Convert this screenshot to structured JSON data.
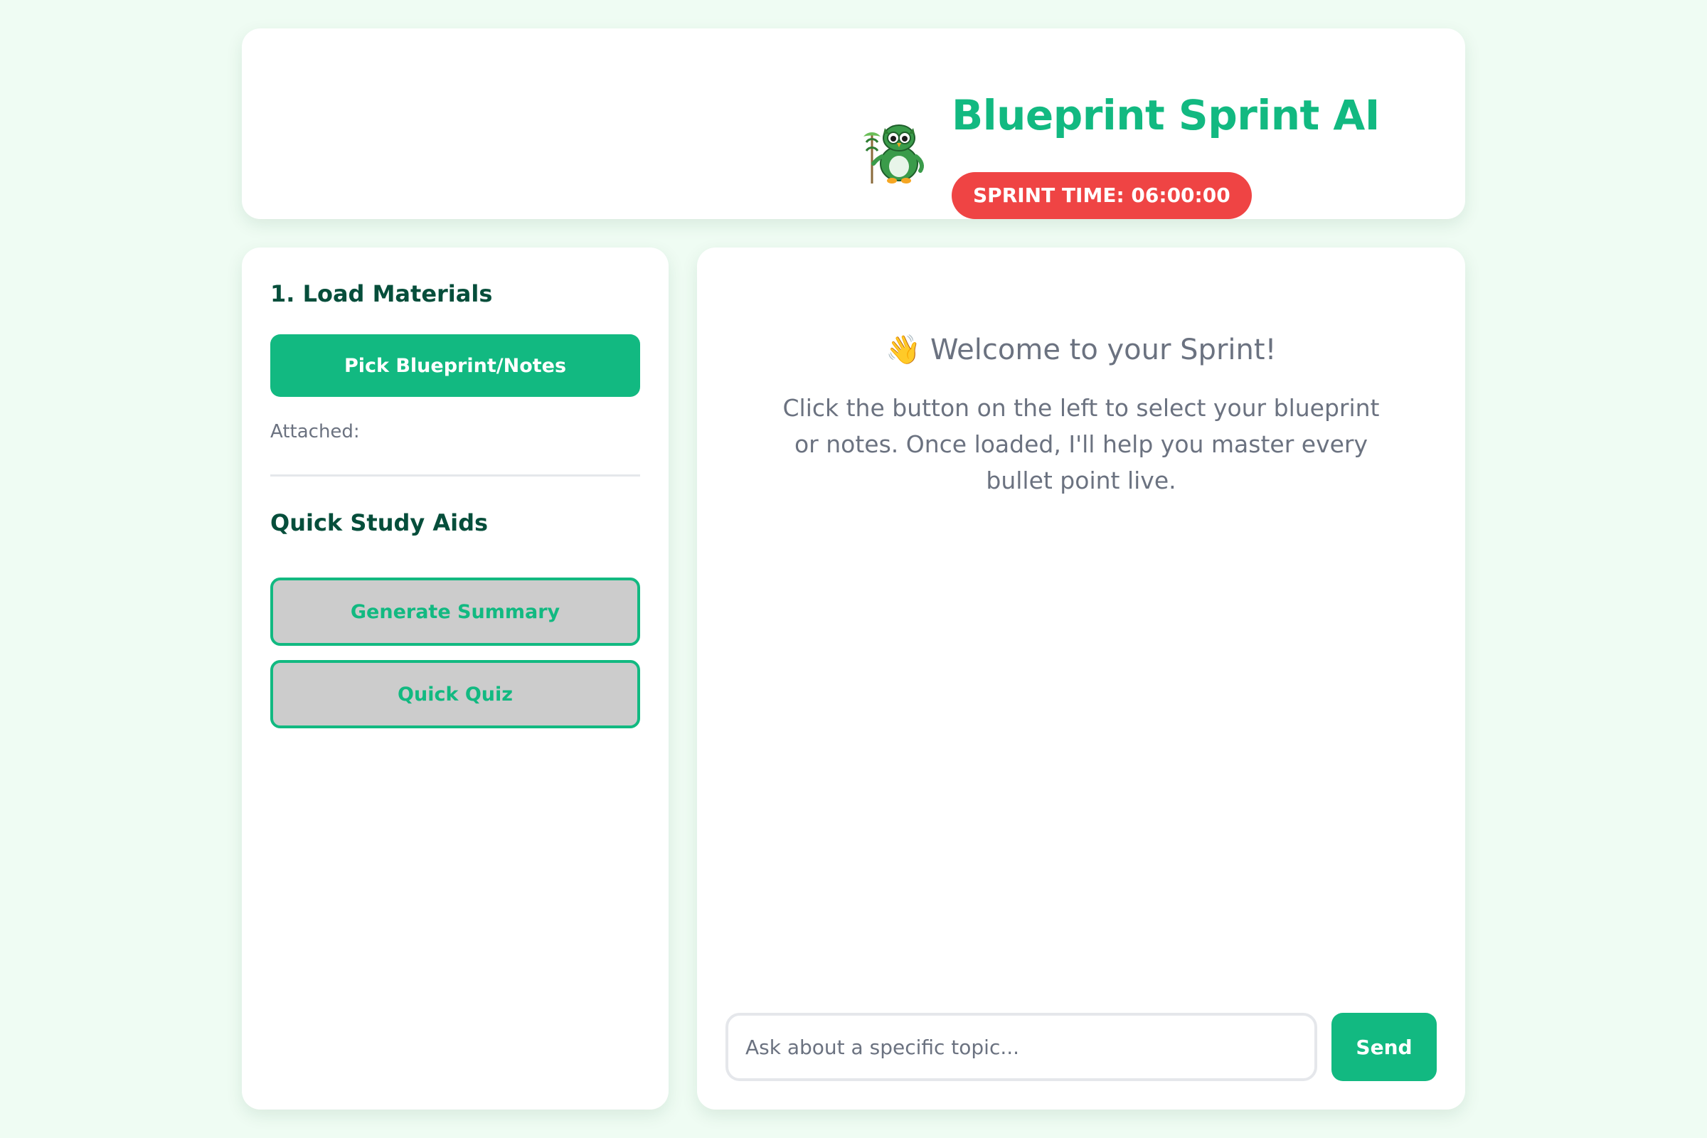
{
  "header": {
    "title": "Blueprint Sprint AI",
    "timer": "SPRINT TIME: 06:00:00",
    "logo_icon": "owl-mascot-icon"
  },
  "sidebar": {
    "load_title": "1. Load Materials",
    "pick_button": "Pick Blueprint/Notes",
    "attached_label": "Attached:",
    "aids_title": "Quick Study Aids",
    "summary_button": "Generate Summary",
    "quiz_button": "Quick Quiz"
  },
  "chat": {
    "welcome_emoji": "👋",
    "welcome_title": "Welcome to your Sprint!",
    "welcome_text": "Click the button on the left to select your blueprint or notes. Once loaded, I'll help you master every bullet point live.",
    "input_placeholder": "Ask about a specific topic...",
    "input_value": "",
    "send_button": "Send"
  },
  "colors": {
    "accent": "#12b981",
    "heading": "#064e3b",
    "timer_bg": "#ef4444",
    "page_bg": "#effcf3",
    "muted_text": "#6b7280",
    "aid_button_bg": "#cccccc"
  }
}
